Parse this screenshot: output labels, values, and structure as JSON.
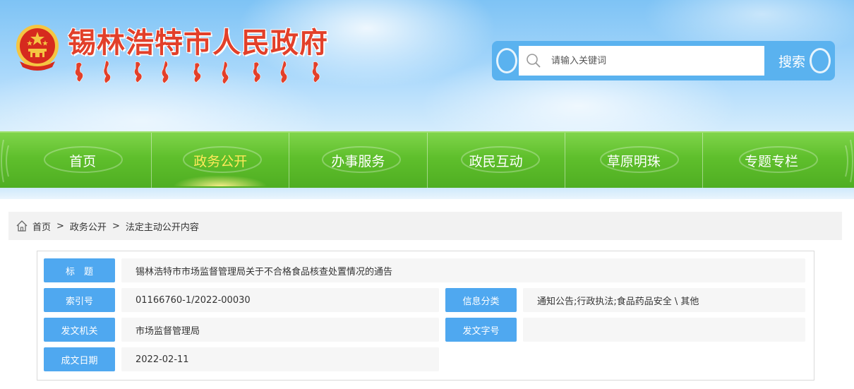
{
  "header": {
    "site_title": "锡林浩特市人民政府",
    "emblem_icon": "national-emblem-icon",
    "search": {
      "placeholder": "请输入关键词",
      "button_label": "搜索"
    }
  },
  "nav": {
    "items": [
      {
        "label": "首页",
        "active": false
      },
      {
        "label": "政务公开",
        "active": true
      },
      {
        "label": "办事服务",
        "active": false
      },
      {
        "label": "政民互动",
        "active": false
      },
      {
        "label": "草原明珠",
        "active": false
      },
      {
        "label": "专题专栏",
        "active": false
      }
    ]
  },
  "breadcrumb": {
    "items": [
      "首页",
      "政务公开",
      "法定主动公开内容"
    ],
    "separator": ">"
  },
  "info": {
    "title_label": "标　题",
    "title_value": "锡林浩特市市场监督管理局关于不合格食品核查处置情况的通告",
    "index_label": "索引号",
    "index_value": "01166760-1/2022-00030",
    "category_label": "信息分类",
    "category_value": "通知公告;行政执法;食品药品安全 \\ 其他",
    "issuer_label": "发文机关",
    "issuer_value": "市场监督管理局",
    "doc_number_label": "发文字号",
    "doc_number_value": "",
    "date_label": "成文日期",
    "date_value": "2022-02-11"
  },
  "colors": {
    "title_red": "#e2402a",
    "nav_green": "#5fbf2c",
    "nav_active": "#ffe95a",
    "label_blue": "#4fa8f0",
    "search_blue": "#5ab2ef"
  }
}
